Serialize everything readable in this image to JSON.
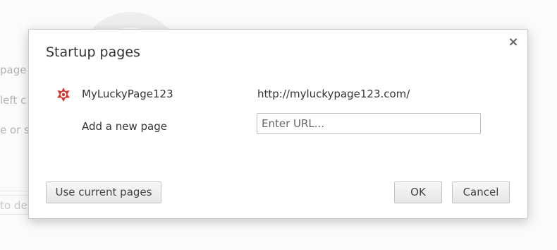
{
  "background": {
    "fragments": [
      "page",
      "left c",
      "e or s",
      "to de"
    ]
  },
  "dialog": {
    "title": "Startup pages",
    "close_glyph": "×",
    "pages": [
      {
        "name": "MyLuckyPage123",
        "url": "http://myluckypage123.com/",
        "icon": "star-badge-icon"
      }
    ],
    "add_page": {
      "label": "Add a new page",
      "placeholder": "Enter URL..."
    },
    "buttons": {
      "use_current": "Use current pages",
      "ok": "OK",
      "cancel": "Cancel"
    }
  },
  "colors": {
    "favicon_red": "#d9302c",
    "dialog_bg": "#ffffff",
    "button_border": "#c3c3c3"
  }
}
